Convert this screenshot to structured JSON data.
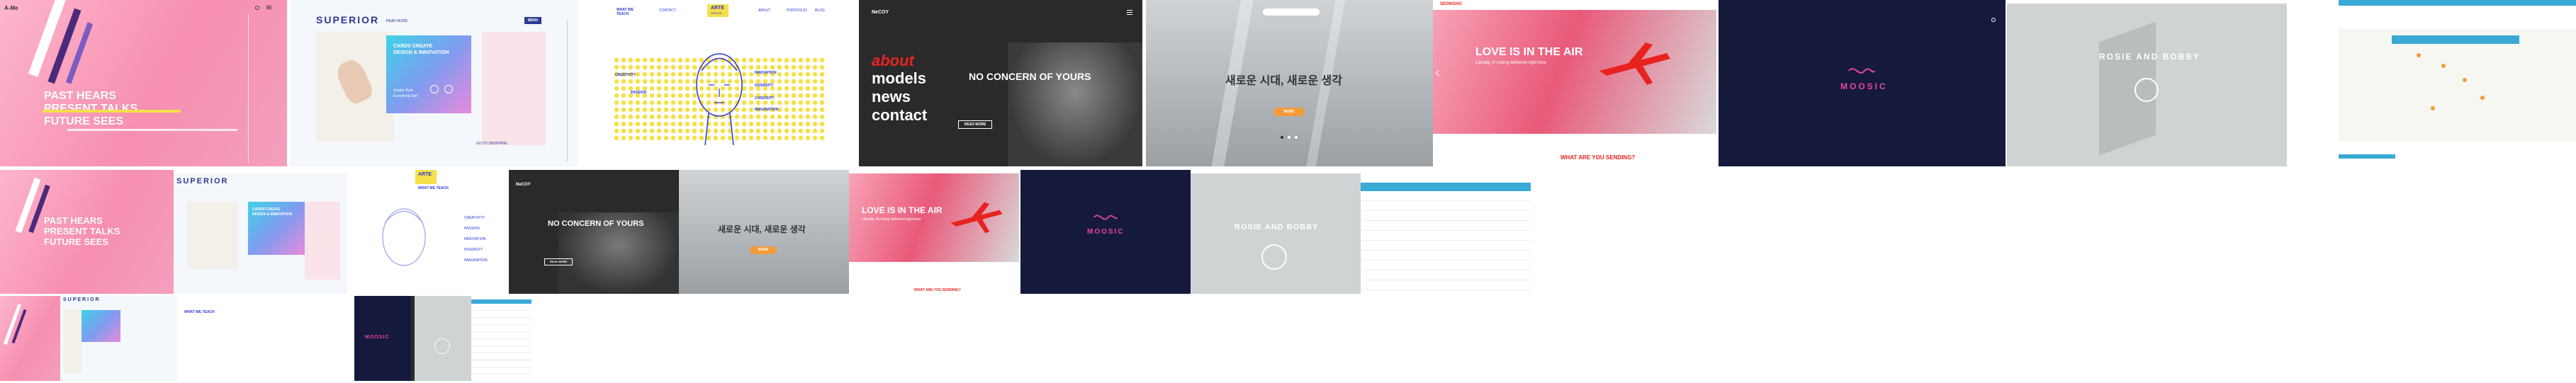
{
  "colors": {
    "pink": "#f78fb0",
    "pink_light": "#fdb6cd",
    "yellow": "#f5e04a",
    "purple": "#4b2a7a",
    "brand_blue": "#2b3a8f",
    "arte_blue": "#2a36d6",
    "dark": "#2a2a2a",
    "red": "#e8231f",
    "navy": "#151a3d",
    "grey": "#cfd3d3",
    "cyan": "#39a9d6",
    "orange": "#f29b38"
  },
  "pink": {
    "logo": "A-Me",
    "heading_line1": "PAST HEARS",
    "heading_line2": "PRESENT TALKS",
    "heading_line3": "FUTURE SEES"
  },
  "superior": {
    "brand": "SUPERIOR",
    "nav_item": "READ MORE",
    "nav_button": "MENU",
    "card_line1": "CARDS CREATE",
    "card_line2": "DESIGN & INNOVATION",
    "card_sub1": "Simple Style",
    "card_sub2": "Everything Soft",
    "footer_link": "GO TO SHOPPING"
  },
  "arte": {
    "nav_left_line1": "WHAT WE",
    "nav_left_line2": "TEACH",
    "logo_top": "ARTE",
    "logo_bottom": "DESIGN",
    "nav_links": [
      "CONTACT",
      "ABOUT",
      "PORTFOLIO",
      "BLOG"
    ],
    "labels": [
      "CREATIVITY",
      "PASSION",
      "INNOVATION",
      "DIVERSITY",
      "CURIOSITY",
      "IMAGINATION"
    ],
    "mobile_title": "WHAT WE TEACH",
    "mobile_labels": [
      "CREATIVITY",
      "PASSION",
      "INNOVATION",
      "DIVERSITY",
      "IMAGINATION"
    ]
  },
  "dark": {
    "brand": "NeCOY",
    "menu_words": [
      "about",
      "models",
      "news",
      "contact"
    ],
    "heading": "NO CONCERN OF YOURS",
    "button": "READ MORE",
    "button_small": "READ MORE"
  },
  "korean": {
    "heading": "새로운 시대, 새로운 생각",
    "button": "MORE"
  },
  "love": {
    "brand": "SEONGHO",
    "heading": "LOVE IS IN THE AIR",
    "subheading": "Literally, it's being delivered right here",
    "section_title": "WHAT ARE YOU SENDING?",
    "section_title_small": "WHAT ARE YOU SENDING?"
  },
  "moosic": {
    "title": "MOOSIC"
  },
  "rosie": {
    "title": "ROSIE AND BOBBY"
  }
}
